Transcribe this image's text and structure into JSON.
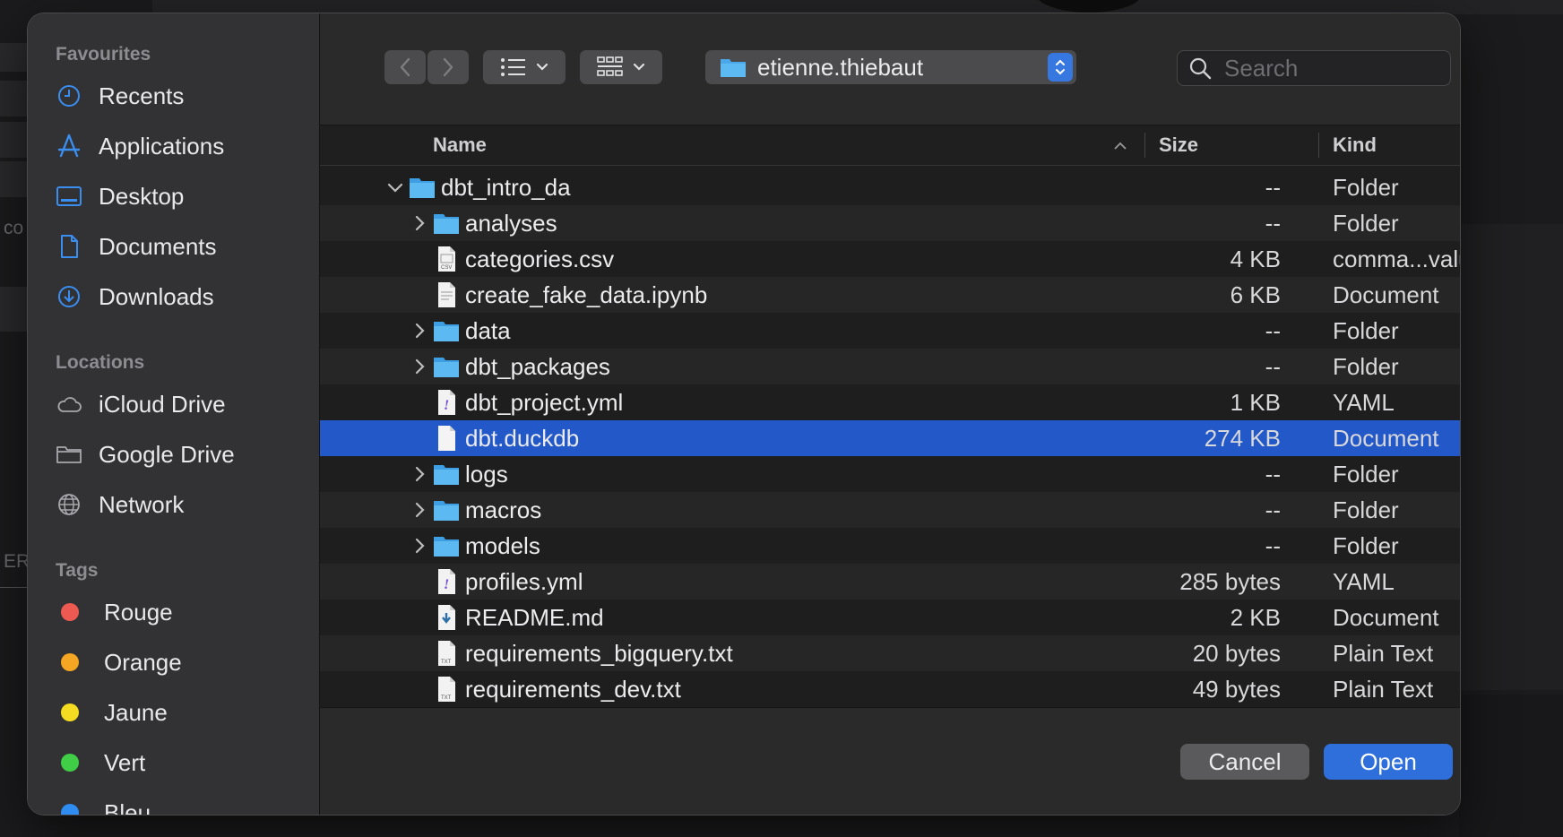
{
  "background": {
    "fragments": [
      "co",
      "ERM"
    ]
  },
  "sidebar": {
    "favourites_heading": "Favourites",
    "favourites": [
      {
        "label": "Recents",
        "icon": "clock-icon"
      },
      {
        "label": "Applications",
        "icon": "applications-icon"
      },
      {
        "label": "Desktop",
        "icon": "desktop-icon"
      },
      {
        "label": "Documents",
        "icon": "document-icon"
      },
      {
        "label": "Downloads",
        "icon": "download-icon"
      }
    ],
    "locations_heading": "Locations",
    "locations": [
      {
        "label": "iCloud Drive",
        "icon": "cloud-icon"
      },
      {
        "label": "Google Drive",
        "icon": "folder-icon"
      },
      {
        "label": "Network",
        "icon": "globe-icon"
      }
    ],
    "tags_heading": "Tags",
    "tags": [
      {
        "label": "Rouge",
        "color": "#ee5a52"
      },
      {
        "label": "Orange",
        "color": "#f5a623"
      },
      {
        "label": "Jaune",
        "color": "#f5dc21"
      },
      {
        "label": "Vert",
        "color": "#3fce46"
      },
      {
        "label": "Bleu",
        "color": "#2f8cf0"
      }
    ]
  },
  "toolbar": {
    "path_label": "etienne.thiebaut",
    "search_placeholder": "Search"
  },
  "columns": {
    "name": "Name",
    "size": "Size",
    "kind": "Kind"
  },
  "files": [
    {
      "name": "dbt_intro_da",
      "size": "--",
      "kind": "Folder",
      "type": "folder",
      "disclosure": "expanded",
      "level": 0
    },
    {
      "name": "analyses",
      "size": "--",
      "kind": "Folder",
      "type": "folder",
      "disclosure": "collapsed",
      "level": 1
    },
    {
      "name": "categories.csv",
      "size": "4 KB",
      "kind": "comma...values",
      "type": "csv",
      "level": 1
    },
    {
      "name": "create_fake_data.ipynb",
      "size": "6 KB",
      "kind": "Document",
      "type": "doc",
      "level": 1
    },
    {
      "name": "data",
      "size": "--",
      "kind": "Folder",
      "type": "folder",
      "disclosure": "collapsed",
      "level": 1
    },
    {
      "name": "dbt_packages",
      "size": "--",
      "kind": "Folder",
      "type": "folder",
      "disclosure": "collapsed",
      "level": 1
    },
    {
      "name": "dbt_project.yml",
      "size": "1 KB",
      "kind": "YAML",
      "type": "yaml",
      "level": 1
    },
    {
      "name": "dbt.duckdb",
      "size": "274 KB",
      "kind": "Document",
      "type": "blank",
      "level": 1,
      "selected": true
    },
    {
      "name": "logs",
      "size": "--",
      "kind": "Folder",
      "type": "folder",
      "disclosure": "collapsed",
      "level": 1
    },
    {
      "name": "macros",
      "size": "--",
      "kind": "Folder",
      "type": "folder",
      "disclosure": "collapsed",
      "level": 1
    },
    {
      "name": "models",
      "size": "--",
      "kind": "Folder",
      "type": "folder",
      "disclosure": "collapsed",
      "level": 1
    },
    {
      "name": "profiles.yml",
      "size": "285 bytes",
      "kind": "YAML",
      "type": "yaml",
      "level": 1
    },
    {
      "name": "README.md",
      "size": "2 KB",
      "kind": "Document",
      "type": "md",
      "level": 1
    },
    {
      "name": "requirements_bigquery.txt",
      "size": "20 bytes",
      "kind": "Plain Text",
      "type": "txt",
      "level": 1
    },
    {
      "name": "requirements_dev.txt",
      "size": "49 bytes",
      "kind": "Plain Text",
      "type": "txt",
      "level": 1
    }
  ],
  "buttons": {
    "cancel": "Cancel",
    "open": "Open"
  },
  "colors": {
    "selection": "#2358c9",
    "accent": "#2f6fdb"
  }
}
